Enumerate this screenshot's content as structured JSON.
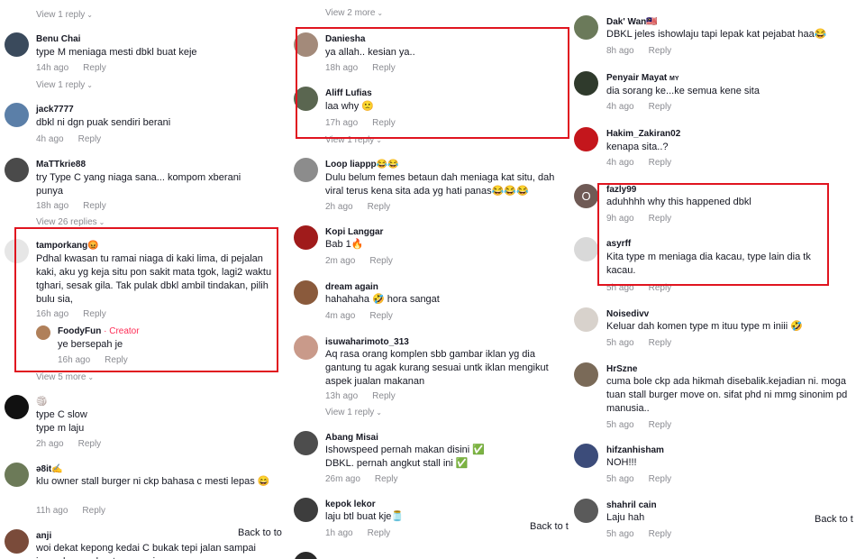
{
  "colors": {
    "highlight_box": "#e0141f",
    "creator_badge": "#fe2c55",
    "meta_text": "#8a8b91"
  },
  "col1": {
    "top_view_reply": "View 1 reply",
    "comments": [
      {
        "user": "Benu Chai",
        "text": "type M meniaga mesti dbkl buat keje",
        "time": "14h ago",
        "reply": "Reply",
        "view_more": "View 1 reply"
      },
      {
        "user": "jack7777",
        "text": "dbkl ni dgn puak sendiri berani",
        "time": "4h ago",
        "reply": "Reply"
      },
      {
        "user": "MaTTkrie88",
        "text": "try Type C yang niaga sana... kompom xberani punya",
        "time": "18h ago",
        "reply": "Reply",
        "view_more": "View 26 replies"
      },
      {
        "user": "tamporkang😡",
        "text": "Pdhal kwasan tu ramai niaga di kaki lima, di pejalan kaki, aku yg keja situ pon sakit mata tgok, lagi2 waktu tghari, sesak gila. Tak pulak dbkl ambil tindakan, pilih bulu sia,",
        "time": "16h ago",
        "reply": "Reply"
      },
      {
        "user": "FoodyFun",
        "badge": "· Creator",
        "text": "ye bersepah je",
        "time": "16h ago",
        "reply": "Reply",
        "view_more": "View 5 more"
      },
      {
        "user": "🏐",
        "text": "type C slow\ntype m laju",
        "time": "2h ago",
        "reply": "Reply"
      },
      {
        "user": "ə8it✍",
        "text": "klu owner stall burger ni ckp bahasa c mesti lepas 😄",
        "time": "11h ago",
        "reply": "Reply"
      },
      {
        "user": "anji",
        "text": "woi dekat kepong kedai C bukak tepi jalan sampai\njemm korang buat senyap je",
        "time": "",
        "reply": ""
      }
    ],
    "back_to_top": "Back to to"
  },
  "col2": {
    "top_view_more": "View 2 more",
    "comments": [
      {
        "user": "Daniesha",
        "text": "ya allah.. kesian ya..",
        "time": "18h ago",
        "reply": "Reply"
      },
      {
        "user": "Aliff Lufias",
        "text": "laa why 🙁",
        "time": "17h ago",
        "reply": "Reply",
        "view_more": "View 1 reply"
      },
      {
        "user": "Loop liappp😂😂",
        "text": "Dulu belum femes betaun dah meniaga kat situ, dah viral terus kena sita ada yg hati panas😂😂😂",
        "time": "2h ago",
        "reply": "Reply"
      },
      {
        "user": "Kopi Langgar",
        "text": "Bab 1🔥",
        "time": "2m ago",
        "reply": "Reply"
      },
      {
        "user": "dream again",
        "text": "hahahaha 🤣 hora sangat",
        "time": "4m ago",
        "reply": "Reply"
      },
      {
        "user": "isuwaharimoto_313",
        "text": "Aq rasa orang komplen sbb gambar iklan yg dia gantung tu agak kurang sesuai untk iklan mengikut aspek jualan makanan",
        "time": "13h ago",
        "reply": "Reply",
        "view_more": "View 1 reply"
      },
      {
        "user": "Abang Misai",
        "text": "Ishowspeed pernah makan disini ✅\nDBKL. pernah angkut stall ini ✅",
        "time": "26m ago",
        "reply": "Reply"
      },
      {
        "user": "kepok lekor",
        "text": "laju btl buat kje🫙",
        "time": "1h ago",
        "reply": "Reply"
      }
    ],
    "back_to_top": "Back to t"
  },
  "col3": {
    "comments": [
      {
        "user": "Dak' Wan🇲🇾",
        "text": "DBKL jeles ishowlaju tapi lepak kat pejabat haa😂",
        "time": "8h ago",
        "reply": "Reply"
      },
      {
        "user": "Penyair Mayat",
        "badge": "MY",
        "text": "dia sorang ke...ke semua kene sita",
        "time": "4h ago",
        "reply": "Reply"
      },
      {
        "user": "Hakim_Zakiran02",
        "text": "kenapa sita..?",
        "time": "4h ago",
        "reply": "Reply"
      },
      {
        "user": "fazly99",
        "text": "aduhhhh why this happened dbkl",
        "time": "9h ago",
        "reply": "Reply"
      },
      {
        "user": "asyrff",
        "text": "Kita type m meniaga dia kacau, type lain dia tk kacau.",
        "time": "5h ago",
        "reply": "Reply"
      },
      {
        "user": "Noisedivv",
        "text": "Keluar dah komen type m ituu type m iniii 🤣",
        "time": "5h ago",
        "reply": "Reply"
      },
      {
        "user": "HrSzne",
        "text": "cuma bole ckp ada hikmah disebalik.kejadian ni. moga tuan stall burger move on. sifat phd ni mmg sinonim pd manusia..",
        "time": "5h ago",
        "reply": "Reply"
      },
      {
        "user": "hifzanhisham",
        "text": "NOH!!!",
        "time": "5h ago",
        "reply": "Reply"
      },
      {
        "user": "shahril cain",
        "text": "Laju hah",
        "time": "5h ago",
        "reply": "Reply"
      }
    ],
    "back_to_top": "Back to t"
  }
}
